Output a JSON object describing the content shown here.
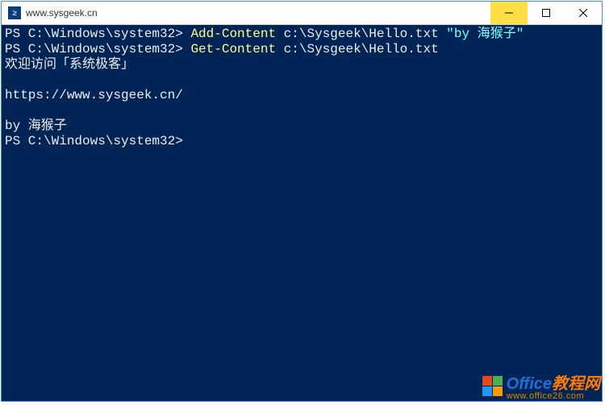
{
  "window": {
    "title": "www.sysgeek.cn",
    "icon_glyph": "≥"
  },
  "lines": [
    {
      "seg": [
        {
          "cls": "p",
          "t": "PS C:\\Windows\\system32> "
        },
        {
          "cls": "c",
          "t": "Add-Content "
        },
        {
          "cls": "a",
          "t": "c:\\Sysgeek\\Hello.txt "
        },
        {
          "cls": "s",
          "t": "\"by 海猴子\""
        }
      ]
    },
    {
      "seg": [
        {
          "cls": "p",
          "t": "PS C:\\Windows\\system32> "
        },
        {
          "cls": "c",
          "t": "Get-Content "
        },
        {
          "cls": "a",
          "t": "c:\\Sysgeek\\Hello.txt"
        }
      ]
    },
    {
      "seg": [
        {
          "cls": "o",
          "t": "欢迎访问「系统极客」"
        }
      ]
    },
    {
      "seg": [
        {
          "cls": "o",
          "t": ""
        }
      ]
    },
    {
      "seg": [
        {
          "cls": "o",
          "t": "https://www.sysgeek.cn/"
        }
      ]
    },
    {
      "seg": [
        {
          "cls": "o",
          "t": ""
        }
      ]
    },
    {
      "seg": [
        {
          "cls": "o",
          "t": "by 海猴子"
        }
      ]
    },
    {
      "seg": [
        {
          "cls": "p",
          "t": "PS C:\\Windows\\system32> "
        }
      ]
    }
  ],
  "watermark": {
    "brand_a": "Office",
    "brand_b": "教程网",
    "url": "www.office26.com"
  }
}
